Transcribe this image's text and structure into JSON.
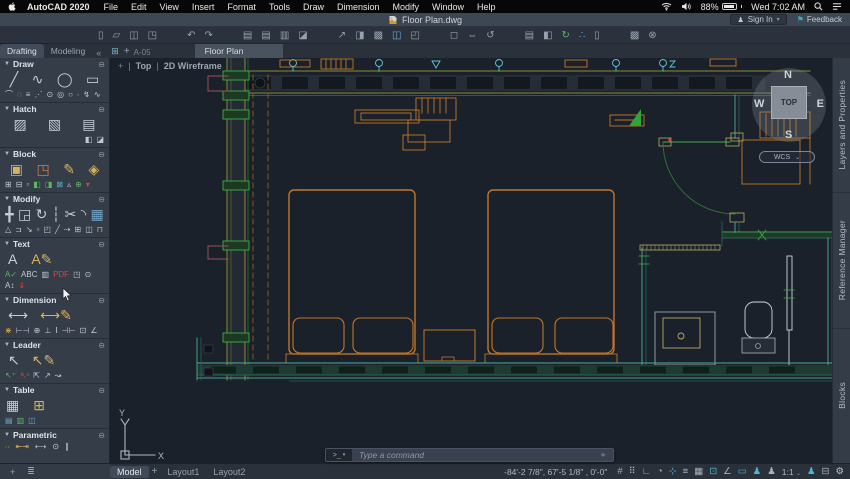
{
  "menubar": {
    "app_name": "AutoCAD 2020",
    "items": [
      "File",
      "Edit",
      "View",
      "Insert",
      "Format",
      "Tools",
      "Draw",
      "Dimension",
      "Modify",
      "Window",
      "Help"
    ],
    "battery": "88%",
    "clock": "Wed 7:02 AM"
  },
  "titlebar": {
    "doc_title": "Floor Plan.dwg",
    "sign_in": "Sign In",
    "feedback": "Feedback"
  },
  "toolbar": {
    "groups": [
      [
        {
          "n": "new-file-icon",
          "g": "▯"
        },
        {
          "n": "open-file-icon",
          "g": "▱"
        },
        {
          "n": "save-icon",
          "g": "◫"
        },
        {
          "n": "save-as-icon",
          "g": "◳"
        }
      ],
      [
        {
          "n": "undo-icon",
          "g": "↶"
        },
        {
          "n": "redo-icon",
          "g": "↷"
        }
      ],
      [
        {
          "n": "print-icon",
          "g": "▤"
        },
        {
          "n": "quick-print-icon",
          "g": "▤"
        },
        {
          "n": "plot-lock-icon",
          "g": "▥"
        },
        {
          "n": "plot-edit-icon",
          "g": "◪"
        }
      ],
      [
        {
          "n": "export-icon",
          "g": "↗"
        },
        {
          "n": "attach-icon",
          "g": "◨"
        },
        {
          "n": "image-ref-icon",
          "g": "▩"
        },
        {
          "n": "dwg-ref-icon",
          "g": "◫",
          "c": "#6fa7c8"
        },
        {
          "n": "ole-icon",
          "g": "◰"
        }
      ],
      [
        {
          "n": "zoom-window-icon",
          "g": "◻"
        },
        {
          "n": "pan-icon",
          "g": "⇔"
        },
        {
          "n": "orbit-icon",
          "g": "↺"
        }
      ],
      [
        {
          "n": "layer-edit-icon",
          "g": "▤"
        },
        {
          "n": "layer-walk-icon",
          "g": "◧"
        },
        {
          "n": "refresh-icon",
          "g": "↻",
          "c": "#5cb85f"
        },
        {
          "n": "point-style-icon",
          "g": "∴",
          "c": "#4fb3d4"
        },
        {
          "n": "block-user-icon",
          "g": "▯"
        }
      ],
      [
        {
          "n": "tool-palettes-icon",
          "g": "▩"
        },
        {
          "n": "settings-remove-icon",
          "g": "⊗"
        }
      ]
    ]
  },
  "ribbon": {
    "drafting": "Drafting",
    "modeling": "Modeling",
    "collapse": "«",
    "add": "+",
    "doc_code": "A-05",
    "file_tab": "Floor Plan"
  },
  "viewport": {
    "plus": "+",
    "sep": "|",
    "view": "Top",
    "style": "2D Wireframe"
  },
  "viewcube": {
    "n": "N",
    "s": "S",
    "e": "E",
    "w": "W",
    "top": "TOP",
    "wcs": "WCS",
    "chev": "⌄"
  },
  "drawing": {
    "ucs_x": "X",
    "ucs_y": "Y"
  },
  "sidebar": {
    "sections": [
      {
        "title": "Draw",
        "big": [
          {
            "n": "line-icon",
            "g": "╱"
          },
          {
            "n": "polyline-icon",
            "g": "∿"
          },
          {
            "n": "circle-icon",
            "g": "◯"
          },
          {
            "n": "rectangle-icon",
            "g": "▭"
          }
        ],
        "small": [
          {
            "n": "arc-icon",
            "g": "⌒"
          },
          {
            "n": "revision-cloud-icon",
            "g": "◌"
          },
          {
            "n": "divide-icon",
            "g": "≡"
          },
          {
            "n": "measure-icon",
            "g": "⋰"
          },
          {
            "n": "ellipse-icon",
            "g": "⊙"
          },
          {
            "n": "ellipse-arc-icon",
            "g": "◎"
          },
          {
            "n": "polygon-icon",
            "g": "○"
          },
          {
            "n": "point-icon",
            "g": "∙"
          },
          {
            "n": "xline-icon",
            "g": "↯"
          },
          {
            "n": "spline-icon",
            "g": "∿"
          }
        ]
      },
      {
        "title": "Hatch",
        "big": [
          {
            "n": "hatch-icon",
            "g": "▨"
          },
          {
            "n": "hatch-edit-icon",
            "g": "▧"
          },
          {
            "n": "gradient-icon",
            "g": "▤"
          }
        ],
        "small": [
          {
            "n": "hatch-settings-icon",
            "g": "◧"
          },
          {
            "n": "gradient-page-icon",
            "g": "◪"
          }
        ]
      },
      {
        "title": "Block",
        "big": [
          {
            "n": "block-insert-icon",
            "g": "▣",
            "c": "#d8b25a"
          },
          {
            "n": "block-create-icon",
            "g": "◳",
            "c": "#cf7b4b"
          },
          {
            "n": "block-edit-icon",
            "g": "✎",
            "c": "#d8b25a"
          },
          {
            "n": "block-tag-icon",
            "g": "◈",
            "c": "#d8b25a"
          }
        ],
        "small": [
          {
            "n": "block-attach-icon",
            "g": "⊞"
          },
          {
            "n": "block-detach-icon",
            "g": "⊟"
          },
          {
            "n": "block-scale-icon",
            "g": "▫"
          },
          {
            "n": "block-sync-icon",
            "g": "◧",
            "c": "#5cb85f"
          },
          {
            "n": "block-save-icon",
            "g": "◨",
            "c": "#5cb85f"
          },
          {
            "n": "block-replace-icon",
            "g": "⊠",
            "c": "#4fb3d4"
          },
          {
            "n": "block-count-icon",
            "g": "▵"
          },
          {
            "n": "block-add-icon",
            "g": "⊕",
            "c": "#5cb85f"
          },
          {
            "n": "block-redefine-icon",
            "g": "▾",
            "c": "#cf4b3d"
          }
        ]
      },
      {
        "title": "Modify",
        "big": [
          {
            "n": "move-icon",
            "g": "╋"
          },
          {
            "n": "copy-icon",
            "g": "◲"
          },
          {
            "n": "rotate-icon",
            "g": "↻"
          },
          {
            "n": "scale-icon",
            "g": "┆"
          },
          {
            "n": "trim-icon",
            "g": "✂"
          },
          {
            "n": "fillet-icon",
            "g": "◝"
          },
          {
            "n": "array-icon",
            "g": "▦",
            "c": "#6fa7c8"
          }
        ],
        "small": [
          {
            "n": "mirror-icon",
            "g": "△"
          },
          {
            "n": "offset-icon",
            "g": "⊐"
          },
          {
            "n": "stretch-icon",
            "g": "↘"
          },
          {
            "n": "erase-icon",
            "g": "▫"
          },
          {
            "n": "explode-icon",
            "g": "◰"
          },
          {
            "n": "lengthen-icon",
            "g": "╱"
          },
          {
            "n": "break-icon",
            "g": "⇢"
          },
          {
            "n": "join-icon",
            "g": "⊞"
          },
          {
            "n": "chamfer-icon",
            "g": "◫"
          },
          {
            "n": "align-icon",
            "g": "⊓",
            "c": "#d8b25a"
          }
        ]
      },
      {
        "title": "Text",
        "big": [
          {
            "n": "mtext-icon",
            "g": "A"
          },
          {
            "n": "text-edit-icon",
            "g": "A✎",
            "c": "#d8b25a"
          }
        ],
        "small": [
          {
            "n": "spell-check-icon",
            "g": "A✓",
            "c": "#5cb85f"
          },
          {
            "n": "text-abc-icon",
            "g": "ABC"
          },
          {
            "n": "text-style-icon",
            "g": "▥"
          },
          {
            "n": "export-pdf-icon",
            "g": "PDF",
            "c": "#cf4b3d"
          },
          {
            "n": "text-frame-icon",
            "g": "◳"
          },
          {
            "n": "find-text-icon",
            "g": "⊙"
          },
          {
            "n": "text-align-icon",
            "g": "A↕"
          },
          {
            "n": "import-pdf-icon",
            "g": "⇓",
            "c": "#cf4b3d"
          }
        ]
      },
      {
        "title": "Dimension",
        "big": [
          {
            "n": "dim-linear-icon",
            "g": "⟷"
          },
          {
            "n": "dim-edit-icon",
            "g": "⟷✎",
            "c": "#d8b25a"
          }
        ],
        "small": [
          {
            "n": "dim-flash-icon",
            "g": "⋇",
            "c": "#d8b25a"
          },
          {
            "n": "dim-aligned-icon",
            "g": "⊢⊣"
          },
          {
            "n": "dim-radius-icon",
            "g": "⊕"
          },
          {
            "n": "dim-baseline-icon",
            "g": "⊥"
          },
          {
            "n": "dim-ordinate-icon",
            "g": "Ⅰ"
          },
          {
            "n": "dim-continue-icon",
            "g": "⊣⊢"
          },
          {
            "n": "dim-box-icon",
            "g": "⊡"
          },
          {
            "n": "dim-angular-icon",
            "g": "∠"
          }
        ]
      },
      {
        "title": "Leader",
        "big": [
          {
            "n": "mleader-icon",
            "g": "↖"
          },
          {
            "n": "mleader-edit-icon",
            "g": "↖✎",
            "c": "#d8b25a"
          }
        ],
        "small": [
          {
            "n": "leader-add-icon",
            "g": "↖⁺",
            "c": "#5cb85f"
          },
          {
            "n": "leader-remove-icon",
            "g": "↖ˣ",
            "c": "#cf4b3d"
          },
          {
            "n": "leader-align-icon",
            "g": "⇱"
          },
          {
            "n": "leader-collect-icon",
            "g": "↗"
          },
          {
            "n": "leader-style-icon",
            "g": "↝"
          }
        ]
      },
      {
        "title": "Table",
        "big": [
          {
            "n": "table-icon",
            "g": "▦"
          },
          {
            "n": "table-link-icon",
            "g": "⊞",
            "c": "#d8b25a"
          }
        ],
        "small": [
          {
            "n": "table-export-icon",
            "g": "▤",
            "c": "#6fa7c8"
          },
          {
            "n": "table-cell-icon",
            "g": "▥",
            "c": "#5cb85f"
          },
          {
            "n": "table-data-icon",
            "g": "◫",
            "c": "#6fa7c8"
          }
        ]
      },
      {
        "title": "Parametric",
        "big": [
          {
            "n": "geometric-constraint-icon",
            "g": "❚",
            "c": "#b5433a"
          }
        ],
        "small": [
          {
            "n": "coincident-icon",
            "g": "∙∙",
            "c": "#d8b25a"
          },
          {
            "n": "fix-icon",
            "g": "⇤⇥",
            "c": "#d8b25a"
          },
          {
            "n": "dim-constraint-icon",
            "g": "⟷"
          },
          {
            "n": "concentric-icon",
            "g": "⊙"
          },
          {
            "n": "parallel-icon",
            "g": "∥"
          }
        ]
      }
    ]
  },
  "right_tabs": [
    {
      "label": "Layers and Properties"
    },
    {
      "label": "Reference Manager"
    },
    {
      "label": "Blocks"
    }
  ],
  "command": {
    "prompt": ">_",
    "chev": "▾",
    "placeholder": "Type a command",
    "tail": "∗"
  },
  "layout_tabs": {
    "model": "Model",
    "add": "+",
    "tabs": [
      "Layout1",
      "Layout2"
    ]
  },
  "statusbar": {
    "coords": "-84'-2 7/8\", 67'-5 1/8\" , 0'-0\"",
    "scale": "1:1",
    "scale_chev": "⌄",
    "icons_left": [
      {
        "n": "grid-icon",
        "g": "#"
      },
      {
        "n": "snap-icon",
        "g": "⠿"
      },
      {
        "n": "ortho-icon",
        "g": "∟"
      },
      {
        "n": "polar-tracking-icon",
        "g": "◔"
      },
      {
        "n": "dynamic-input-icon",
        "g": "⊹",
        "c": "#4fb3d4"
      },
      {
        "n": "lineweight-icon",
        "g": "≡"
      },
      {
        "n": "transparency-icon",
        "g": "▦"
      },
      {
        "n": "selection-cycling-icon",
        "g": "⊡",
        "c": "#4fb3d4"
      },
      {
        "n": "isometric-icon",
        "g": "∠"
      },
      {
        "n": "annotation-icon",
        "g": "▭",
        "c": "#4fb3d4"
      },
      {
        "n": "annotation-visibility-icon",
        "g": "♟",
        "c": "#4fb3d4"
      },
      {
        "n": "autoscale-icon",
        "g": "♟"
      }
    ],
    "icons_right": [
      {
        "n": "workspace-icon",
        "g": "♟",
        "c": "#4fb3d4"
      },
      {
        "n": "units-icon",
        "g": "⊟"
      },
      {
        "n": "customize-gear-icon",
        "g": "⚙",
        "c": "#b8c0ca"
      }
    ],
    "left_icons": [
      {
        "n": "add-sheet-icon",
        "g": "+"
      },
      {
        "n": "layer-list-icon",
        "g": "≣"
      }
    ]
  }
}
